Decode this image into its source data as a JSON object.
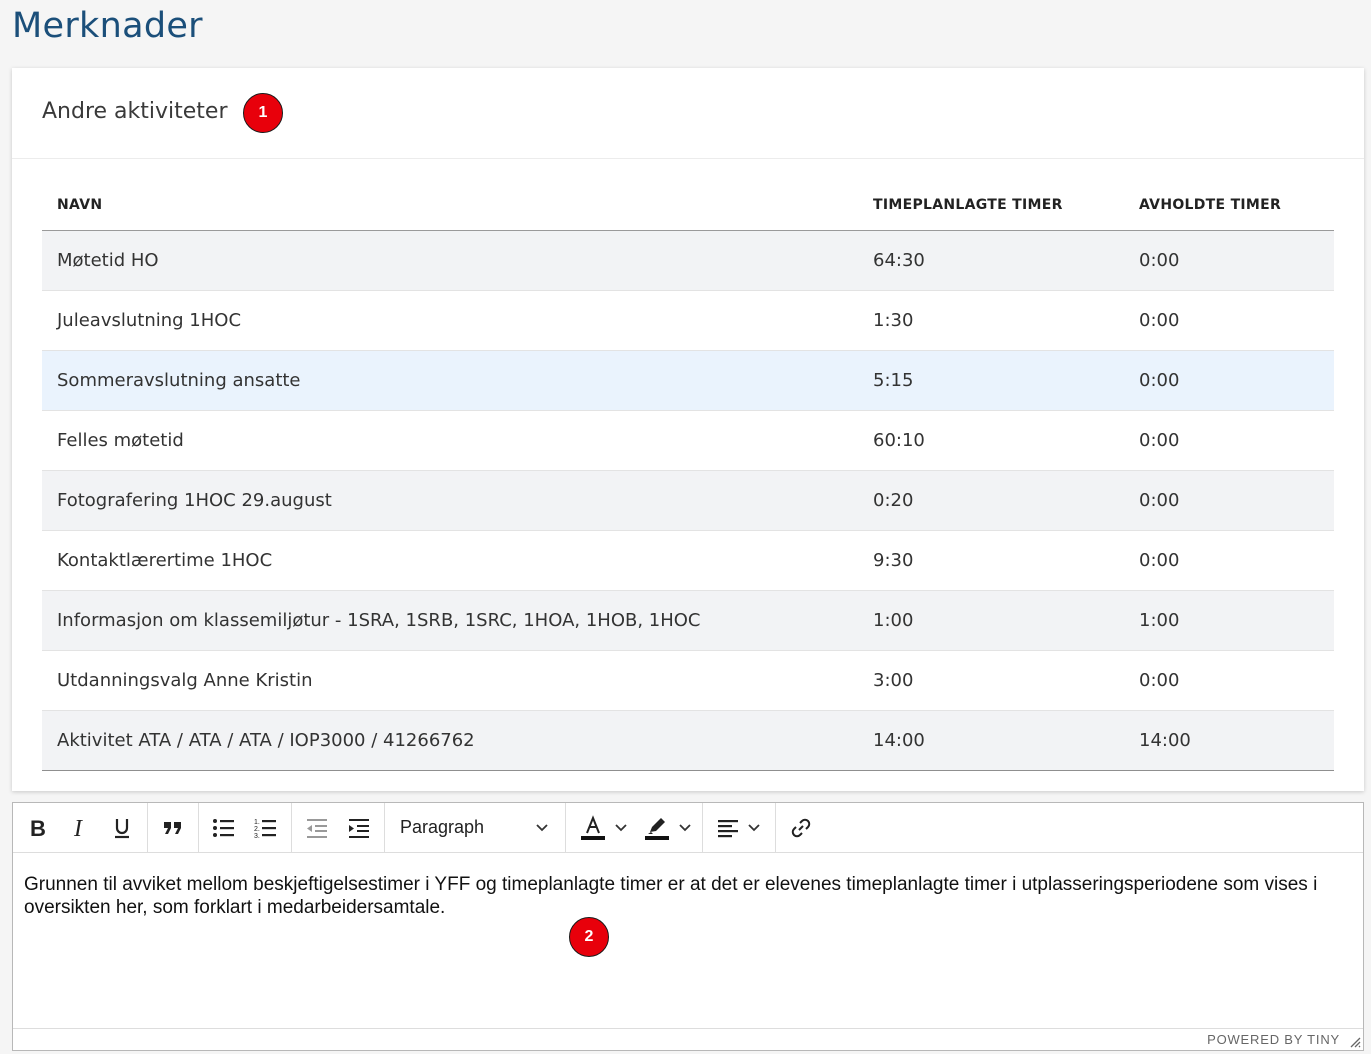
{
  "page_title": "Merknader",
  "section": {
    "title": "Andre aktiviteter",
    "marker": "1"
  },
  "table": {
    "headers": [
      "NAVN",
      "TIMEPLANLAGTE TIMER",
      "AVHOLDTE TIMER"
    ],
    "rows": [
      {
        "name": "Møtetid HO",
        "planned": "64:30",
        "held": "0:00"
      },
      {
        "name": "Juleavslutning 1HOC",
        "planned": "1:30",
        "held": "0:00"
      },
      {
        "name": "Sommeravslutning ansatte",
        "planned": "5:15",
        "held": "0:00"
      },
      {
        "name": "Felles møtetid",
        "planned": "60:10",
        "held": "0:00"
      },
      {
        "name": "Fotografering 1HOC 29.august",
        "planned": "0:20",
        "held": "0:00"
      },
      {
        "name": "Kontaktlærertime 1HOC",
        "planned": "9:30",
        "held": "0:00"
      },
      {
        "name": "Informasjon om klassemiljøtur - 1SRA, 1SRB, 1SRC, 1HOA, 1HOB, 1HOC",
        "planned": "1:00",
        "held": "1:00"
      },
      {
        "name": "Utdanningsvalg Anne Kristin",
        "planned": "3:00",
        "held": "0:00"
      },
      {
        "name": "Aktivitet ATA / ATA / ATA / IOP3000 / 41266762",
        "planned": "14:00",
        "held": "14:00"
      }
    ]
  },
  "editor": {
    "block_format": "Paragraph",
    "content": "Grunnen til avviket mellom beskjeftigelsestimer i YFF og timeplanlagte timer er at det er elevenes timeplanlagte timer i utplasseringsperiodene som vises i oversikten her, som forklart i medarbeidersamtale.",
    "marker": "2",
    "powered_by": "POWERED BY TINY"
  },
  "colors": {
    "title": "#1b4f7a",
    "marker": "#e8000b",
    "row_stripe": "#f2f3f5",
    "row_highlight": "#eaf3fd"
  }
}
